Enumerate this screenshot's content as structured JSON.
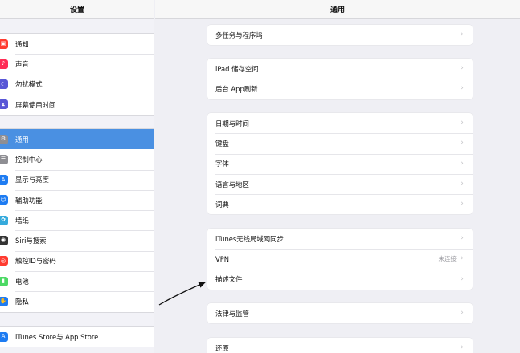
{
  "sidebar": {
    "title": "设置",
    "group1": [
      {
        "label": "通知",
        "icon": "notifications-icon",
        "color": "#ff3b30",
        "glyph": "▣"
      },
      {
        "label": "声音",
        "icon": "sound-icon",
        "color": "#ff2d55",
        "glyph": "♪"
      },
      {
        "label": "勿扰模式",
        "icon": "moon-icon",
        "color": "#5856d6",
        "glyph": "☾"
      },
      {
        "label": "屏幕使用时间",
        "icon": "hourglass-icon",
        "color": "#5856d6",
        "glyph": "⧗"
      }
    ],
    "group2": [
      {
        "label": "通用",
        "icon": "gear-icon",
        "color": "#8e8e93",
        "glyph": "⚙",
        "selected": true
      },
      {
        "label": "控制中心",
        "icon": "toggles-icon",
        "color": "#8e8e93",
        "glyph": "☰"
      },
      {
        "label": "显示与亮度",
        "icon": "display-icon",
        "color": "#1e7cf2",
        "glyph": "A"
      },
      {
        "label": "辅助功能",
        "icon": "accessibility-icon",
        "color": "#1e7cf2",
        "glyph": "☺"
      },
      {
        "label": "墙纸",
        "icon": "wallpaper-icon",
        "color": "#35aadc",
        "glyph": "✿"
      },
      {
        "label": "Siri与搜索",
        "icon": "siri-icon",
        "color": "#333333",
        "glyph": "◉"
      },
      {
        "label": "触控ID与密码",
        "icon": "fingerprint-icon",
        "color": "#ff3b30",
        "glyph": "◎"
      },
      {
        "label": "电池",
        "icon": "battery-icon",
        "color": "#4cd964",
        "glyph": "▮"
      },
      {
        "label": "隐私",
        "icon": "privacy-hand-icon",
        "color": "#1e7cf2",
        "glyph": "✋"
      }
    ],
    "group3": [
      {
        "label": "iTunes Store与 App Store",
        "icon": "app-store-icon",
        "color": "#1e7cf2",
        "glyph": "A"
      }
    ]
  },
  "main": {
    "title": "通用",
    "group_a": [
      {
        "label": "多任务与程序坞"
      }
    ],
    "group_b": [
      {
        "label": "iPad 储存空间"
      },
      {
        "label": "后台 App刷新"
      }
    ],
    "group_c": [
      {
        "label": "日期与时间"
      },
      {
        "label": "键盘"
      },
      {
        "label": "字体"
      },
      {
        "label": "语言与地区"
      },
      {
        "label": "词典"
      }
    ],
    "group_d": [
      {
        "label": "iTunes无线局域网同步"
      },
      {
        "label": "VPN",
        "value": "未连接"
      },
      {
        "label": "描述文件"
      }
    ],
    "group_e": [
      {
        "label": "法律与监管"
      }
    ],
    "group_f": [
      {
        "label": "还原"
      }
    ]
  },
  "chevron": "›"
}
